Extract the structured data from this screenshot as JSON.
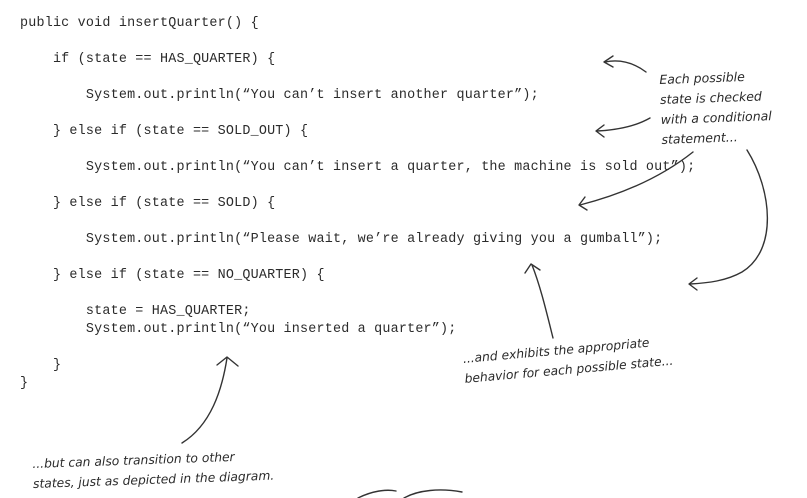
{
  "code": {
    "lines": [
      "public void insertQuarter() {",
      "    if (state == HAS_QUARTER) {",
      "        System.out.println(“You can’t insert another quarter”);",
      "    } else if (state == SOLD_OUT) {",
      "        System.out.println(“You can’t insert a quarter, the machine is sold out”);",
      "    } else if (state == SOLD) {",
      "        System.out.println(“Please wait, we’re already giving you a gumball”);",
      "    } else if (state == NO_QUARTER) {",
      "        state = HAS_QUARTER;",
      "        System.out.println(“You inserted a quarter”);",
      "    }",
      "}"
    ]
  },
  "annotations": {
    "top": "Each possible\nstate is checked\nwith a conditional\nstatement...",
    "middle": "...and exhibits the appropriate\nbehavior for each possible state...",
    "bottom": "...but can also transition to other\nstates, just as depicted in the diagram."
  }
}
